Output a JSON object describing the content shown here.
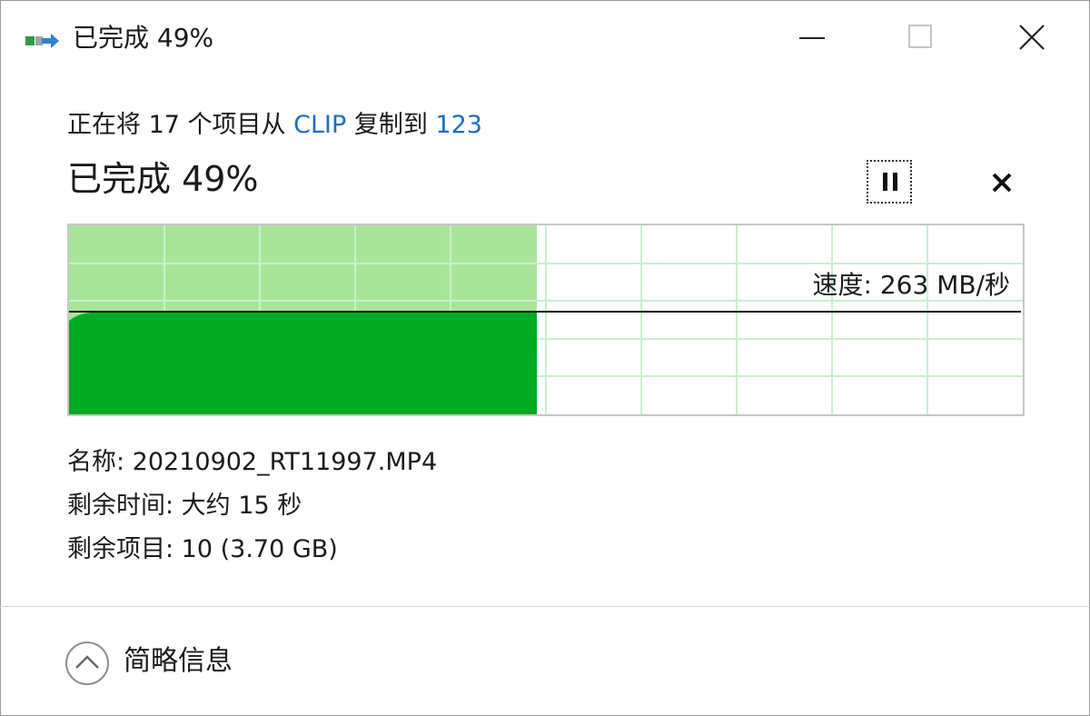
{
  "window": {
    "title": "已完成 49%",
    "controls": {
      "minimize": "minimize-icon",
      "maximize": "maximize-icon",
      "close": "close-icon"
    }
  },
  "copy": {
    "prefix": "正在将 17 个项目从 ",
    "source": "CLIP",
    "middle": " 复制到 ",
    "destination": "123"
  },
  "progress": {
    "label": "已完成 49%",
    "percent": 49,
    "pause_icon": "pause-icon",
    "cancel_icon": "close-icon"
  },
  "speed_chart": {
    "speed_label": "速度: 263 MB/秒",
    "colors": {
      "fill": "#00aa22",
      "fill_light": "#a8e59a",
      "grid": "#c9f0cf",
      "speed_line": "#111111"
    }
  },
  "details": {
    "name": "名称: 20210902_RT11997.MP4",
    "time_remaining": "剩余时间: 大约 15 秒",
    "items_remaining": "剩余项目: 10 (3.70 GB)"
  },
  "footer": {
    "toggle_label": "简略信息",
    "toggle_icon": "chevron-up-icon"
  }
}
